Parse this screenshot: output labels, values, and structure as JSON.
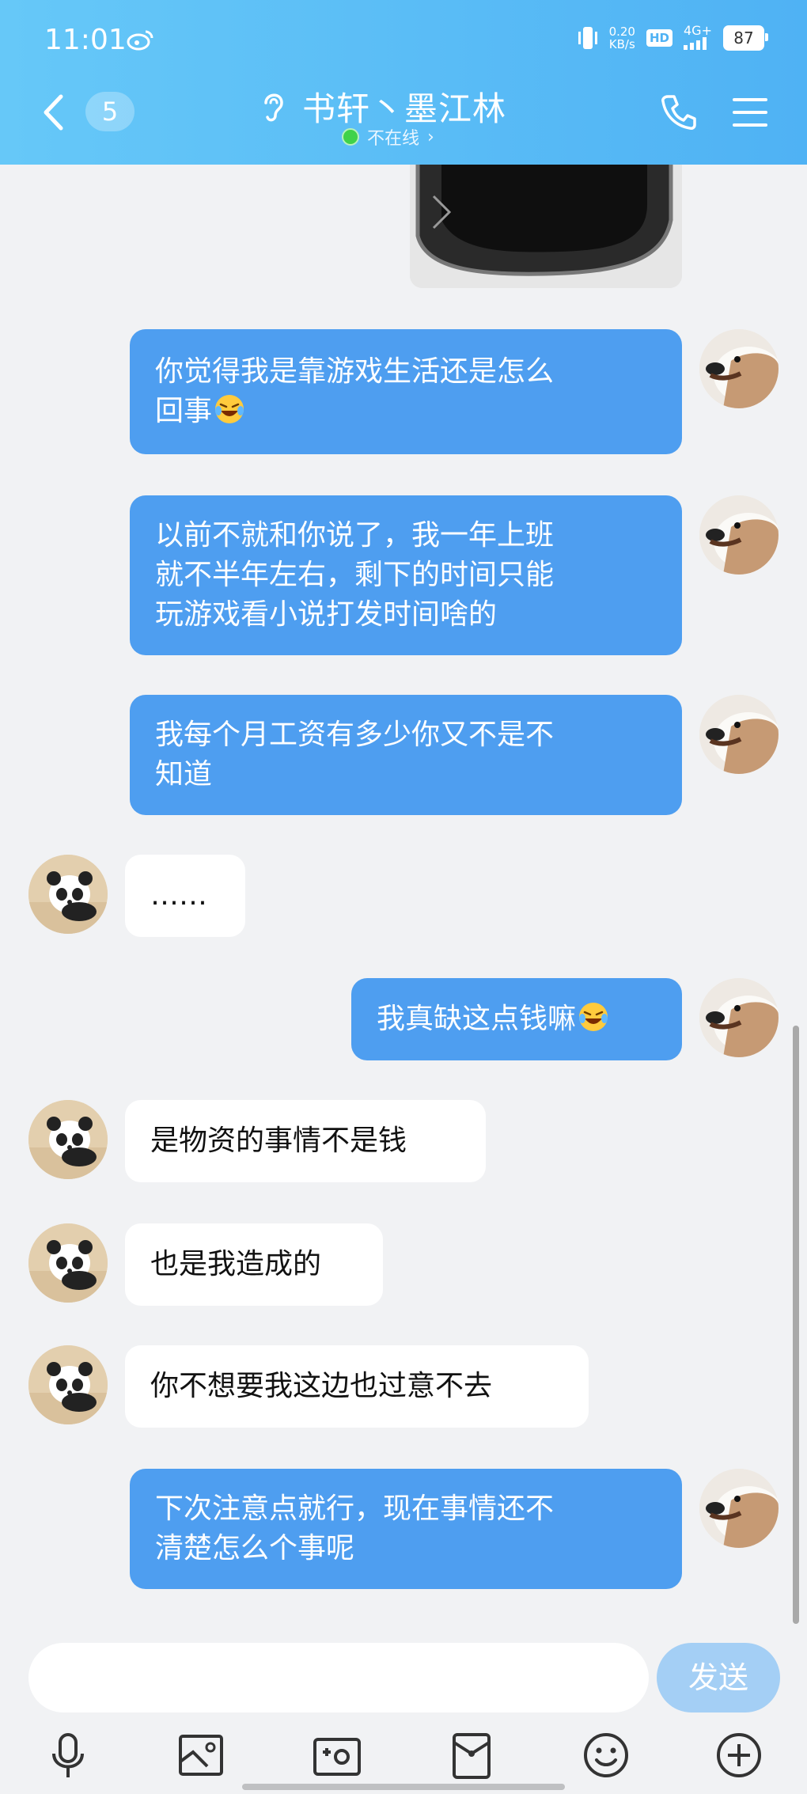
{
  "status_bar": {
    "time": "11:01",
    "net_speed": "0.20",
    "net_speed_unit": "KB/s",
    "hd": "HD",
    "signal": "4G+",
    "battery": "87"
  },
  "header": {
    "unread_count": "5",
    "contact_name": "书轩丶墨江林",
    "presence": "不在线",
    "presence_arrow": "›",
    "icons": {
      "back": "back-arrow-icon",
      "listen": "ear-icon",
      "call": "phone-icon",
      "menu": "menu-icon"
    }
  },
  "messages": [
    {
      "side": "mine",
      "lines": [
        "你觉得我是靠游戏生活还是怎么",
        "回事"
      ],
      "emoji": "laugh-cry-emoji"
    },
    {
      "side": "mine",
      "lines": [
        "以前不就和你说了，我一年上班",
        "就不半年左右，剩下的时间只能",
        "玩游戏看小说打发时间啥的"
      ]
    },
    {
      "side": "mine",
      "lines": [
        "我每个月工资有多少你又不是不",
        "知道"
      ]
    },
    {
      "side": "theirs",
      "lines": [
        "……"
      ]
    },
    {
      "side": "mine",
      "lines": [
        "我真缺这点钱嘛"
      ],
      "emoji": "laugh-cry-emoji"
    },
    {
      "side": "theirs",
      "lines": [
        "是物资的事情不是钱"
      ]
    },
    {
      "side": "theirs",
      "lines": [
        "也是我造成的"
      ]
    },
    {
      "side": "theirs",
      "lines": [
        "你不想要我这边也过意不去"
      ]
    },
    {
      "side": "mine",
      "lines": [
        "下次注意点就行，现在事情还不",
        "清楚怎么个事呢"
      ]
    }
  ],
  "input": {
    "placeholder": "",
    "value": "",
    "send_label": "发送"
  },
  "toolbar": [
    "microphone-icon",
    "image-icon",
    "camera-icon",
    "red-packet-icon",
    "emoji-icon",
    "plus-icon"
  ]
}
